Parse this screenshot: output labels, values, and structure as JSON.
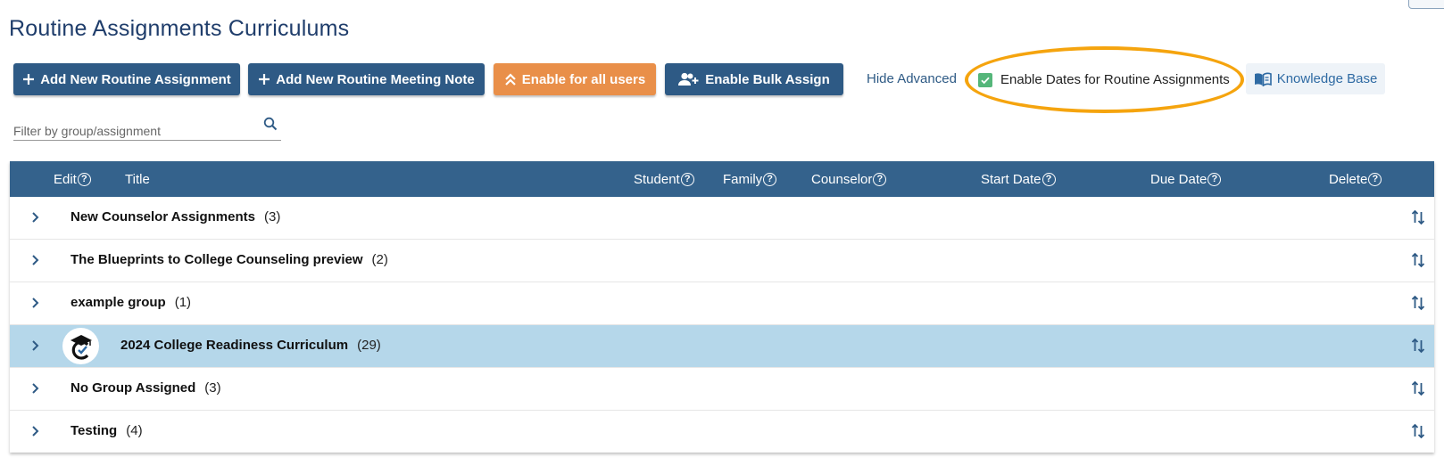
{
  "page": {
    "title": "Routine Assignments Curriculums"
  },
  "toolbar": {
    "add_assignment": "Add New Routine Assignment",
    "add_note": "Add New Routine Meeting Note",
    "enable_all": "Enable for all users",
    "bulk_assign": "Enable Bulk Assign",
    "hide_advanced": "Hide Advanced",
    "enable_dates": "Enable Dates for Routine Assignments",
    "enable_dates_checked": true,
    "knowledge_base": "Knowledge Base"
  },
  "filter": {
    "placeholder": "Filter by group/assignment",
    "value": ""
  },
  "table": {
    "columns": {
      "edit": "Edit",
      "title": "Title",
      "student": "Student",
      "family": "Family",
      "counselor": "Counselor",
      "start_date": "Start Date",
      "due_date": "Due Date",
      "delete": "Delete"
    },
    "help_glyph": "?",
    "rows": [
      {
        "name": "New Counselor Assignments",
        "count": "(3)"
      },
      {
        "name": "The Blueprints to College Counseling preview",
        "count": "(2)"
      },
      {
        "name": "example group",
        "count": "(1)"
      },
      {
        "name": "2024 College Readiness Curriculum",
        "count": "(29)",
        "selected": true,
        "has_logo": true
      },
      {
        "name": "No Group Assigned",
        "count": "(3)"
      },
      {
        "name": "Testing",
        "count": "(4)"
      }
    ]
  },
  "colors": {
    "primary": "#2e5a85",
    "header": "#34628c",
    "orange": "#e98f49",
    "selected_row": "#b5d7ea",
    "highlight": "#f5a40e",
    "checkbox": "#55b67a"
  }
}
